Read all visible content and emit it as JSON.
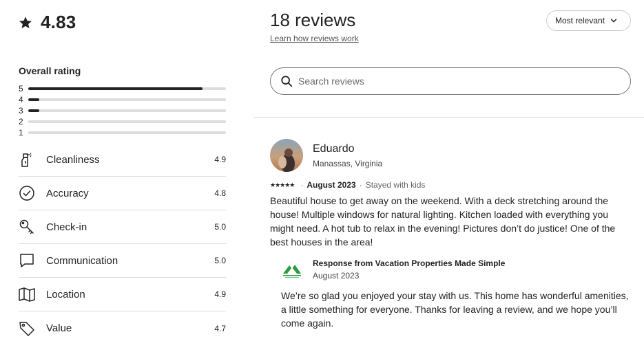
{
  "summary": {
    "average": "4.83",
    "overall_label": "Overall rating",
    "distribution": [
      {
        "stars": "5",
        "fraction": 0.88
      },
      {
        "stars": "4",
        "fraction": 0.055
      },
      {
        "stars": "3",
        "fraction": 0.055
      },
      {
        "stars": "2",
        "fraction": 0.0
      },
      {
        "stars": "1",
        "fraction": 0.0
      }
    ],
    "categories": [
      {
        "name": "Cleanliness",
        "value": "4.9",
        "icon": "spray-bottle-icon"
      },
      {
        "name": "Accuracy",
        "value": "4.8",
        "icon": "check-circle-icon"
      },
      {
        "name": "Check-in",
        "value": "5.0",
        "icon": "key-icon"
      },
      {
        "name": "Communication",
        "value": "5.0",
        "icon": "chat-bubble-icon"
      },
      {
        "name": "Location",
        "value": "4.9",
        "icon": "map-icon"
      },
      {
        "name": "Value",
        "value": "4.7",
        "icon": "tag-icon"
      }
    ]
  },
  "header": {
    "title": "18 reviews",
    "learn_link": "Learn how reviews work",
    "sort_label": "Most relevant"
  },
  "search": {
    "placeholder": "Search reviews"
  },
  "review": {
    "name": "Eduardo",
    "location": "Manassas, Virginia",
    "stars": "★★★★★",
    "date": "August 2023",
    "separator": "·",
    "stay_type": "Stayed with kids",
    "body": "Beautiful house to get away on the weekend. With a deck stretching around the house! Multiple windows for natural lighting. Kitchen loaded with everything you might need. A hot tub to relax in the evening! Pictures don’t do justice! One of the best houses in the area!",
    "response": {
      "title": "Response from Vacation Properties Made Simple",
      "date": "August 2023",
      "body": "We’re so glad you enjoyed your stay with us. This home has wonderful amenities, a little something for everyone. Thanks for leaving a review, and we hope you’ll come again."
    }
  },
  "colors": {
    "text": "#222222",
    "muted": "#6a6a6a",
    "divider": "#dddddd",
    "brand_green": "#2e9b3f"
  }
}
